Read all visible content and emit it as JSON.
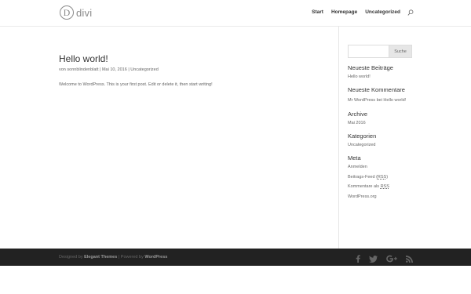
{
  "header": {
    "logo_letter": "D",
    "logo_word": "divi",
    "nav": [
      "Start",
      "Homepage",
      "Uncategorized"
    ],
    "search_icon": "search-icon"
  },
  "post": {
    "title": "Hello world!",
    "meta_prefix": "von",
    "author": "sonnblindenblatt",
    "date": "Mai 10, 2016",
    "category": "Uncategorized",
    "body": "Welcome to WordPress. This is your first post. Edit or delete it, then start writing!"
  },
  "sidebar": {
    "search_button": "Suche",
    "search_value": "",
    "recent_posts_title": "Neueste Beiträge",
    "recent_posts": [
      "Hello world!"
    ],
    "recent_comments_title": "Neueste Kommentare",
    "recent_comment": "Mr WordPress bei Hello world!",
    "archive_title": "Archive",
    "archive": [
      "Mai 2016"
    ],
    "categories_title": "Kategorien",
    "categories": [
      "Uncategorized"
    ],
    "meta_title": "Meta",
    "meta_login": "Anmelden",
    "meta_feed_prefix": "Beitrags-Feed (",
    "meta_feed_rss": "RSS",
    "meta_comments_prefix": "Kommentare als ",
    "meta_comments_rss": "RSS",
    "meta_wp": "WordPress.org"
  },
  "footer": {
    "designed_by": "Designed by",
    "elegant_themes": "Elegant Themes",
    "powered_by": "| Powered by",
    "wordpress": "WordPress",
    "social_icons": [
      "facebook-icon",
      "twitter-icon",
      "google-plus-icon",
      "rss-icon"
    ]
  },
  "colors": {
    "accent": "#2ea3f2",
    "footer_bg": "#222222",
    "text": "#666666",
    "heading": "#333333"
  }
}
